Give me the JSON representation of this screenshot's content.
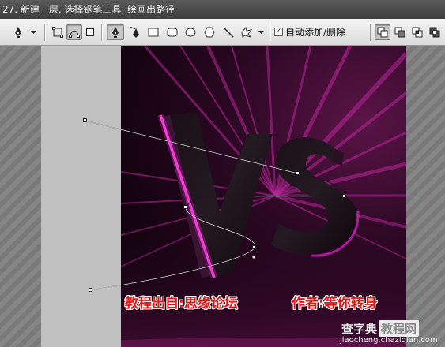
{
  "title": "27. 新建一层, 选择钢笔工具, 绘画出路径",
  "toolbar": {
    "tools": [
      {
        "name": "pen-tool-preset-icon",
        "kind": "pen"
      },
      {
        "name": "shape-layers-icon",
        "kind": "shape-layer"
      },
      {
        "name": "paths-mode-icon",
        "kind": "paths",
        "selected": true
      },
      {
        "name": "fill-pixels-icon",
        "kind": "fill-pixels"
      },
      {
        "name": "pen-icon",
        "kind": "pen",
        "selected": true
      },
      {
        "name": "freeform-pen-icon",
        "kind": "freeform-pen"
      },
      {
        "name": "rectangle-icon",
        "kind": "rect"
      },
      {
        "name": "rounded-rectangle-icon",
        "kind": "rounded-rect"
      },
      {
        "name": "ellipse-icon",
        "kind": "ellipse"
      },
      {
        "name": "polygon-icon",
        "kind": "polygon"
      },
      {
        "name": "line-icon",
        "kind": "line"
      },
      {
        "name": "custom-shape-icon",
        "kind": "custom-shape"
      },
      {
        "name": "add-to-path-icon",
        "kind": "add",
        "selected": true
      },
      {
        "name": "subtract-path-icon",
        "kind": "subtract"
      },
      {
        "name": "intersect-path-icon",
        "kind": "intersect"
      },
      {
        "name": "exclude-path-icon",
        "kind": "exclude"
      }
    ],
    "auto_add_delete": {
      "label": "自动添加/删除",
      "checked": true
    }
  },
  "canvas": {
    "captions": {
      "source": "教程出自:思缘论坛",
      "author": "作者:等你转身"
    },
    "artwork_text": "VS"
  },
  "watermark": {
    "brand": "查字典",
    "sub": "教程网",
    "url": "jiaocheng.chazidian.com"
  },
  "colors": {
    "accent_magenta": "#d01fb8",
    "caption_red": "#e11616"
  }
}
